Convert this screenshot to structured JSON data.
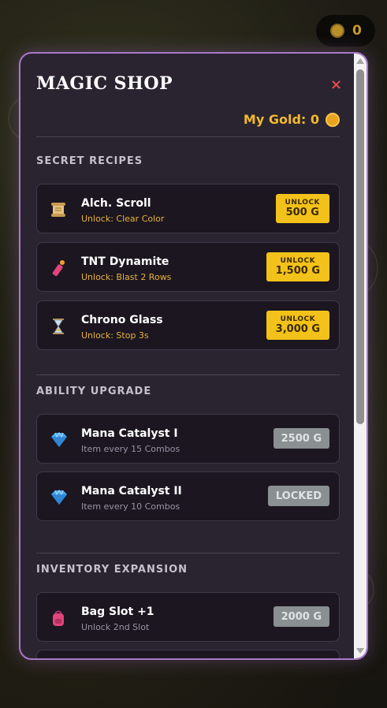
{
  "hud": {
    "gold_count": "0",
    "coin_icon": "coin-icon"
  },
  "shop": {
    "title": "MAGIC SHOP",
    "close_glyph": "×",
    "gold_label": "My Gold: 0",
    "sections": [
      {
        "title": "SECRET RECIPES",
        "items": [
          {
            "name": "Alch. Scroll",
            "desc": "Unlock: Clear Color",
            "button_top": "UNLOCK",
            "button_price": "500 G",
            "icon": "scroll-icon"
          },
          {
            "name": "TNT Dynamite",
            "desc": "Unlock: Blast 2 Rows",
            "button_top": "UNLOCK",
            "button_price": "1,500 G",
            "icon": "dynamite-icon"
          },
          {
            "name": "Chrono Glass",
            "desc": "Unlock: Stop 3s",
            "button_top": "UNLOCK",
            "button_price": "3,000 G",
            "icon": "hourglass-icon"
          }
        ]
      },
      {
        "title": "ABILITY UPGRADE",
        "items": [
          {
            "name": "Mana Catalyst I",
            "desc": "Item every 15 Combos",
            "button": "2500 G",
            "icon": "gem-icon"
          },
          {
            "name": "Mana Catalyst II",
            "desc": "Item every 10 Combos",
            "button": "LOCKED",
            "icon": "gem-icon"
          }
        ]
      },
      {
        "title": "INVENTORY EXPANSION",
        "items": [
          {
            "name": "Bag Slot +1",
            "desc": "Unlock 2nd Slot",
            "button": "2000 G",
            "icon": "backpack-icon"
          }
        ]
      }
    ]
  },
  "colors": {
    "accent_gold": "#f3c21a",
    "border_purple": "#a879c9",
    "close_red": "#e64b4b"
  }
}
